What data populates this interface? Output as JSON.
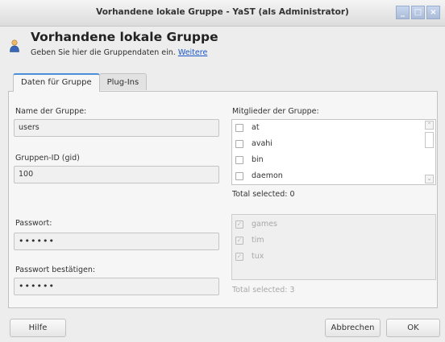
{
  "window": {
    "title": "Vorhandene lokale Gruppe - YaST (als Administrator)",
    "buttons": [
      "_",
      "□",
      "×"
    ]
  },
  "header": {
    "title": "Vorhandene lokale Gruppe",
    "subtitle": "Geben Sie hier die Gruppendaten ein.",
    "more_link": "Weitere"
  },
  "tabs": [
    {
      "label": "Daten für Gruppe",
      "active": true
    },
    {
      "label": "Plug-Ins",
      "active": false
    }
  ],
  "form": {
    "name_label": "Name der Gruppe:",
    "name_value": "users",
    "gid_label": "Gruppen-ID (gid)",
    "gid_value": "100",
    "password_label": "Passwort:",
    "password_value": "••••••",
    "password_confirm_label": "Passwort bestätigen:",
    "password_confirm_value": "••••••"
  },
  "members": {
    "label": "Mitglieder der Gruppe:",
    "items": [
      "at",
      "avahi",
      "bin",
      "daemon"
    ],
    "total": "Total selected: 0"
  },
  "system_members": {
    "items": [
      "games",
      "tim",
      "tux"
    ],
    "total": "Total selected: 3"
  },
  "buttons": {
    "help": "Hilfe",
    "cancel": "Abbrechen",
    "ok": "OK"
  }
}
